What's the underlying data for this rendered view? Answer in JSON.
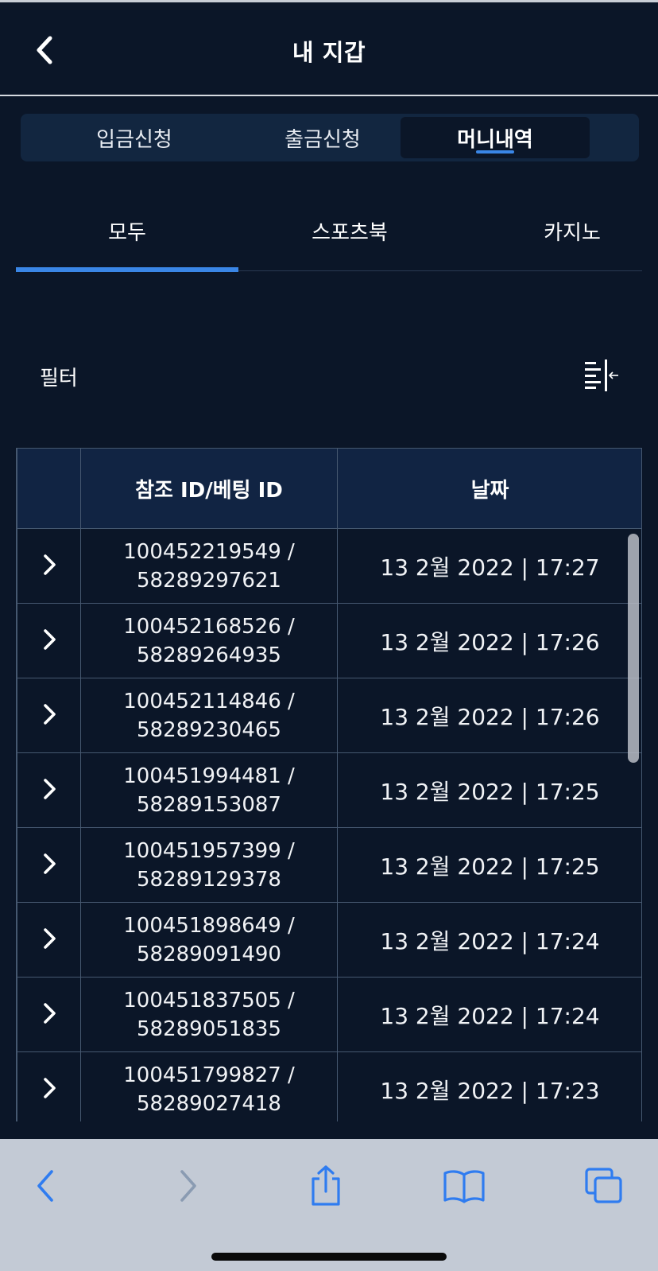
{
  "header": {
    "title": "내 지갑",
    "back_icon": "chevron-left-icon"
  },
  "segments": [
    {
      "label": "입금신청",
      "active": false
    },
    {
      "label": "출금신청",
      "active": false
    },
    {
      "label": "머니내역",
      "active": true
    }
  ],
  "subtabs": [
    {
      "label": "모두",
      "active": true
    },
    {
      "label": "스포츠북",
      "active": false
    },
    {
      "label": "카지노",
      "active": false
    }
  ],
  "filter": {
    "label": "필터",
    "icon": "filter-panel-icon"
  },
  "table": {
    "headers": [
      "",
      "참조 ID/베팅 ID",
      "날짜"
    ],
    "rows": [
      {
        "ref": "100452219549 /",
        "bet": "58289297621",
        "date": "13 2월 2022 | 17:27"
      },
      {
        "ref": "100452168526 /",
        "bet": "58289264935",
        "date": "13 2월 2022 | 17:26"
      },
      {
        "ref": "100452114846 /",
        "bet": "58289230465",
        "date": "13 2월 2022 | 17:26"
      },
      {
        "ref": "100451994481 /",
        "bet": "58289153087",
        "date": "13 2월 2022 | 17:25"
      },
      {
        "ref": "100451957399 /",
        "bet": "58289129378",
        "date": "13 2월 2022 | 17:25"
      },
      {
        "ref": "100451898649 /",
        "bet": "58289091490",
        "date": "13 2월 2022 | 17:24"
      },
      {
        "ref": "100451837505 /",
        "bet": "58289051835",
        "date": "13 2월 2022 | 17:24"
      },
      {
        "ref": "100451799827 /",
        "bet": "58289027418",
        "date": "13 2월 2022 | 17:23"
      }
    ]
  },
  "browser_toolbar": {
    "icons": [
      "back-icon",
      "forward-icon",
      "share-icon",
      "bookmarks-icon",
      "tabs-icon"
    ]
  },
  "colors": {
    "background": "#0b1628",
    "accent": "#3a86e6",
    "header_cell": "#112443",
    "toolbar": "#c3cad5",
    "toolbar_icon": "#2f7cf0"
  }
}
